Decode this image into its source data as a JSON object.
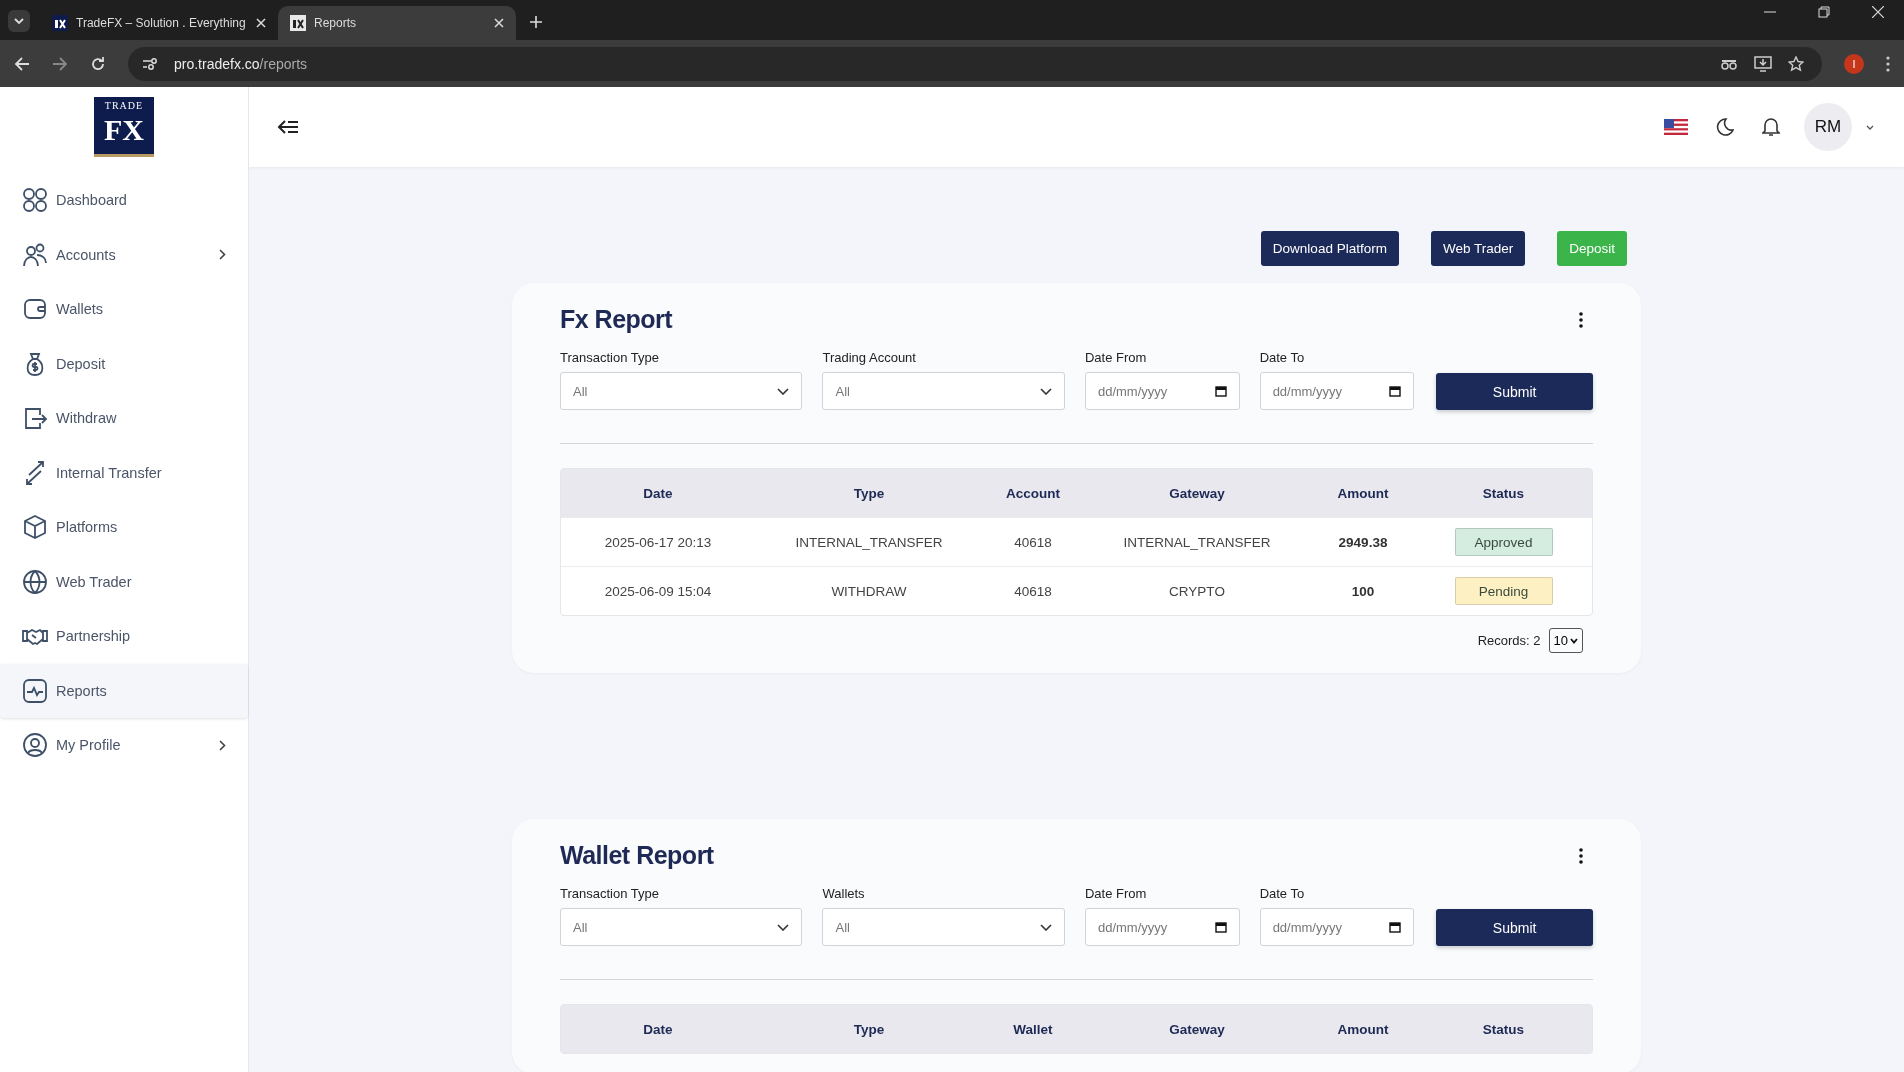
{
  "browser": {
    "tabs": [
      {
        "title": "TradeFX – Solution . Everything",
        "selected": false
      },
      {
        "title": "Reports",
        "selected": true
      }
    ],
    "url_host": "pro.tradefx.co",
    "url_path": "/reports",
    "profile_initial": "I"
  },
  "sidebar": {
    "logo": {
      "top": "TRADE",
      "main": "FX"
    },
    "items": [
      {
        "label": "Dashboard",
        "selected": false,
        "submenu": false
      },
      {
        "label": "Accounts",
        "selected": false,
        "submenu": true
      },
      {
        "label": "Wallets",
        "selected": false,
        "submenu": false
      },
      {
        "label": "Deposit",
        "selected": false,
        "submenu": false
      },
      {
        "label": "Withdraw",
        "selected": false,
        "submenu": false
      },
      {
        "label": "Internal Transfer",
        "selected": false,
        "submenu": false
      },
      {
        "label": "Platforms",
        "selected": false,
        "submenu": false
      },
      {
        "label": "Web Trader",
        "selected": false,
        "submenu": false
      },
      {
        "label": "Partnership",
        "selected": false,
        "submenu": false
      },
      {
        "label": "Reports",
        "selected": true,
        "submenu": false
      },
      {
        "label": "My Profile",
        "selected": false,
        "submenu": true
      }
    ]
  },
  "header": {
    "avatar": "RM"
  },
  "actions": [
    {
      "label": "Download Platform",
      "kind": "primary"
    },
    {
      "label": "Web Trader",
      "kind": "primary"
    },
    {
      "label": "Deposit",
      "kind": "success"
    }
  ],
  "reports": [
    {
      "title": "Fx Report",
      "filters": [
        {
          "label": "Transaction Type",
          "kind": "select",
          "value": "All"
        },
        {
          "label": "Trading Account",
          "kind": "select",
          "value": "All"
        },
        {
          "label": "Date From",
          "kind": "date",
          "placeholder": "dd/mm/yyyy"
        },
        {
          "label": "Date To",
          "kind": "date",
          "placeholder": "dd/mm/yyyy"
        }
      ],
      "submit": "Submit",
      "columns": [
        "Date",
        "Type",
        "Account",
        "Gateway",
        "Amount",
        "Status"
      ],
      "rows": [
        {
          "cells": [
            "2025-06-17 20:13",
            "INTERNAL_TRANSFER",
            "40618",
            "INTERNAL_TRANSFER",
            "2949.38"
          ],
          "status": "Approved",
          "color": "#d5ece0"
        },
        {
          "cells": [
            "2025-06-09 15:04",
            "WITHDRAW",
            "40618",
            "CRYPTO",
            "100"
          ],
          "status": "Pending",
          "color": "#fdf1c4"
        }
      ],
      "records": "Records: 2",
      "page_size": "10"
    },
    {
      "title": "Wallet Report",
      "filters": [
        {
          "label": "Transaction Type",
          "kind": "select",
          "value": "All"
        },
        {
          "label": "Wallets",
          "kind": "select",
          "value": "All"
        },
        {
          "label": "Date From",
          "kind": "date",
          "placeholder": "dd/mm/yyyy"
        },
        {
          "label": "Date To",
          "kind": "date",
          "placeholder": "dd/mm/yyyy"
        }
      ],
      "submit": "Submit",
      "columns": [
        "Date",
        "Type",
        "Wallet",
        "Gateway",
        "Amount",
        "Status"
      ]
    }
  ]
}
